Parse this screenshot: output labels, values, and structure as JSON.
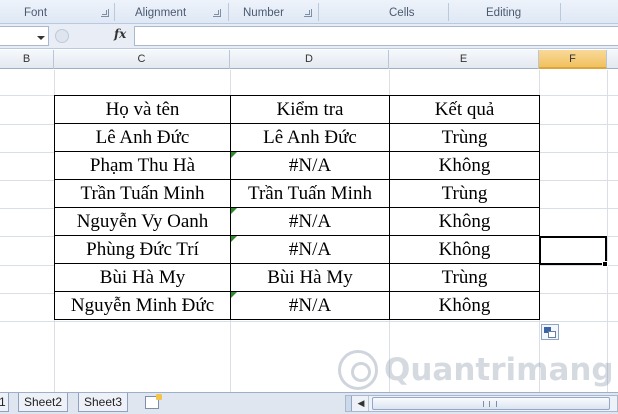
{
  "ribbon": {
    "groups": [
      "Font",
      "Alignment",
      "Number",
      "Cells",
      "Editing"
    ]
  },
  "formula_bar": {
    "fx_label": "fx",
    "value": ""
  },
  "columns": [
    "B",
    "C",
    "D",
    "E",
    "F"
  ],
  "selected_column": "F",
  "table": {
    "headers": [
      "Họ và tên",
      "Kiểm tra",
      "Kết quả"
    ],
    "rows": [
      {
        "name": "Lê Anh Đức",
        "check": "Lê Anh Đức",
        "result": "Trùng"
      },
      {
        "name": "Phạm Thu Hà",
        "check": "#N/A",
        "result": "Không"
      },
      {
        "name": "Trần Tuấn Minh",
        "check": "Trần Tuấn Minh",
        "result": "Trùng"
      },
      {
        "name": "Nguyễn Vy Oanh",
        "check": "#N/A",
        "result": "Không"
      },
      {
        "name": "Phùng Đức Trí",
        "check": "#N/A",
        "result": "Không"
      },
      {
        "name": "Bùi Hà My",
        "check": "Bùi Hà My",
        "result": "Trùng"
      },
      {
        "name": "Nguyễn Minh Đức",
        "check": "#N/A",
        "result": "Không"
      }
    ]
  },
  "sheet_tabs": {
    "partial": "1",
    "tabs": [
      "Sheet2",
      "Sheet3"
    ]
  },
  "watermark": "Quantrimang",
  "colors": {
    "ribbon_bg": "#dfe8f5",
    "selected_header": "#f1c15f",
    "error_marker": "#2e8b2e"
  }
}
